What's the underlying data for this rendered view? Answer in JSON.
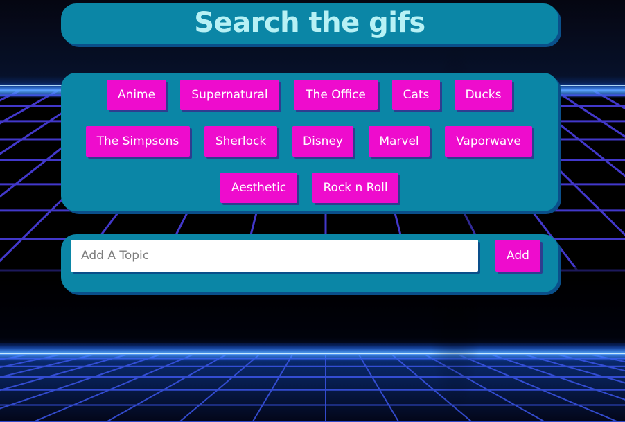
{
  "header": {
    "title": "Search the gifs"
  },
  "topics": [
    "Anime",
    "Supernatural",
    "The Office",
    "Cats",
    "Ducks",
    "The Simpsons",
    "Sherlock",
    "Disney",
    "Marvel",
    "Vaporwave",
    "Aesthetic",
    "Rock n Roll"
  ],
  "add_form": {
    "placeholder": "Add A Topic",
    "value": "",
    "button_label": "Add"
  },
  "colors": {
    "panel": "#0b86a6",
    "button": "#ee0ccd",
    "title_text": "#b7f1f5",
    "grid_lines": "#4a3fe0",
    "horizon_glow": "#3a8cff"
  }
}
